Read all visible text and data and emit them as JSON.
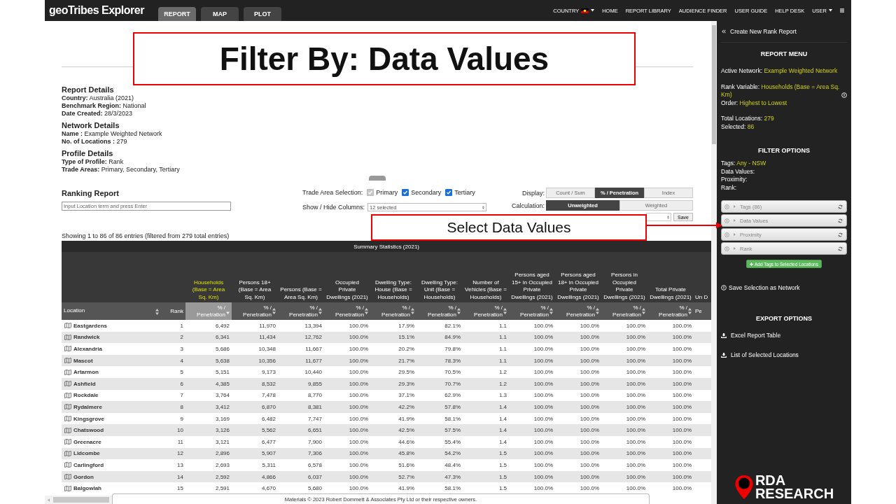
{
  "slide_title": "Filter By: Data Values",
  "callout": "Select Data Values",
  "app": {
    "logo": "geoTribes Explorer",
    "tabs": [
      {
        "label": "REPORT",
        "selected": true
      },
      {
        "label": "MAP",
        "selected": false
      },
      {
        "label": "PLOT",
        "selected": false
      }
    ],
    "nav": [
      {
        "label": "COUNTRY",
        "kind": "flag"
      },
      {
        "label": "HOME",
        "kind": "plain"
      },
      {
        "label": "REPORT LIBRARY",
        "kind": "plain"
      },
      {
        "label": "AUDIENCE FINDER",
        "kind": "plain"
      },
      {
        "label": "USER GUIDE",
        "kind": "plain"
      },
      {
        "label": "HELP DESK",
        "kind": "plain"
      },
      {
        "label": "USER",
        "kind": "caret"
      }
    ]
  },
  "details": [
    {
      "title": "Report Details",
      "lines": [
        "**Country:** Australia (2021)",
        "**Benchmark Region:** National",
        "**Date Created:** 28/3/2023"
      ]
    },
    {
      "title": "Network Details",
      "lines": [
        "**Name :** Example Weighted Network",
        "**No. of Locations :** 279"
      ]
    },
    {
      "title": "Profile Details",
      "lines": [
        "**Type of Profile:** Rank",
        "**Trade Areas:** Primary, Secondary, Tertiary"
      ]
    }
  ],
  "ranking": {
    "title": "Ranking Report",
    "search_placeholder": "Input Location term and press Enter",
    "trade_label": "Trade Area Selection:",
    "trade_areas": [
      {
        "label": "Primary",
        "checked": true,
        "disabled": true
      },
      {
        "label": "Secondary",
        "checked": true,
        "disabled": false
      },
      {
        "label": "Tertiary",
        "checked": true,
        "disabled": false
      }
    ],
    "columns_label": "Show / Hide Columns:",
    "columns_value": "12 selected",
    "display_label": "Display:",
    "display": [
      {
        "label": "Count / Sum",
        "selected": false
      },
      {
        "label": "% / Penetration",
        "selected": true
      },
      {
        "label": "Index",
        "selected": false
      }
    ],
    "calc_label": "Calculation:",
    "calculation": [
      {
        "label": "Unweighted",
        "selected": true
      },
      {
        "label": "Weighted",
        "selected": false
      }
    ],
    "save": "Save"
  },
  "showing": "Showing 1 to 86 of 86 entries (filtered from 279 total entries)",
  "table": {
    "group_heading": "Summary Statistics (2021)",
    "columns": [
      {
        "label": "Location",
        "kind": "name",
        "sortable": true,
        "selected": false
      },
      {
        "label": "Rank",
        "kind": "rank",
        "sortable": false,
        "selected": false
      },
      {
        "label": "Households (Base = Area Sq. Km)",
        "unit": "% / Penetration",
        "kind": "metric",
        "sortable": true,
        "selected": true
      },
      {
        "label": "Persons 18+ (Base = Area Sq. Km)",
        "unit": "% / Penetration",
        "kind": "metric",
        "sortable": true,
        "selected": false
      },
      {
        "label": "Persons (Base = Area Sq. Km)",
        "unit": "% / Penetration",
        "kind": "metric",
        "sortable": true,
        "selected": false
      },
      {
        "label": "Occupied Private Dwellings (2021)",
        "unit": "% / Penetration",
        "kind": "metric",
        "sortable": true,
        "selected": false
      },
      {
        "label": "Dwelling Type: House (Base = Households)",
        "unit": "% / Penetration",
        "kind": "metric",
        "sortable": true,
        "selected": false
      },
      {
        "label": "Dwelling Type: Unit (Base = Households)",
        "unit": "% / Penetration",
        "kind": "metric",
        "sortable": true,
        "selected": false
      },
      {
        "label": "Number of Vehicles (Base = Households)",
        "unit": "% / Penetration",
        "kind": "metric",
        "sortable": true,
        "selected": false
      },
      {
        "label": "Persons aged 15+ in Occupied Private Dwellings (2021)",
        "unit": "% / Penetration",
        "kind": "metric",
        "sortable": true,
        "selected": false
      },
      {
        "label": "Persons aged 18+ in Occupied Private Dwellings (2021)",
        "unit": "% / Penetration",
        "kind": "metric",
        "sortable": true,
        "selected": false
      },
      {
        "label": "Persons in Occupied Private Dwellings (2021)",
        "unit": "% / Penetration",
        "kind": "metric",
        "sortable": true,
        "selected": false
      },
      {
        "label": "Total Private Dwellings (2021)",
        "unit": "% / Penetration",
        "kind": "metric",
        "sortable": true,
        "selected": false
      },
      {
        "label": "Un D",
        "unit": "Pe",
        "kind": "cut",
        "sortable": false,
        "selected": false
      }
    ],
    "rows": [
      [
        "Eastgardens",
        "1",
        "6,492",
        "11,970",
        "13,394",
        "100.0%",
        "17.9%",
        "82.1%",
        "1.1",
        "100.0%",
        "100.0%",
        "100.0%",
        "100.0%"
      ],
      [
        "Randwick",
        "2",
        "6,341",
        "11,434",
        "12,762",
        "100.0%",
        "15.1%",
        "84.9%",
        "1.1",
        "100.0%",
        "100.0%",
        "100.0%",
        "100.0%"
      ],
      [
        "Alexandria",
        "3",
        "5,686",
        "10,348",
        "11,667",
        "100.0%",
        "20.2%",
        "79.8%",
        "1.1",
        "100.0%",
        "100.0%",
        "100.0%",
        "100.0%"
      ],
      [
        "Mascot",
        "4",
        "5,638",
        "10,356",
        "11,677",
        "100.0%",
        "21.7%",
        "78.3%",
        "1.1",
        "100.0%",
        "100.0%",
        "100.0%",
        "100.0%"
      ],
      [
        "Artarmon",
        "5",
        "5,151",
        "9,173",
        "10,440",
        "100.0%",
        "29.5%",
        "70.5%",
        "1.2",
        "100.0%",
        "100.0%",
        "100.0%",
        "100.0%"
      ],
      [
        "Ashfield",
        "6",
        "4,385",
        "8,532",
        "9,855",
        "100.0%",
        "29.3%",
        "70.7%",
        "1.2",
        "100.0%",
        "100.0%",
        "100.0%",
        "100.0%"
      ],
      [
        "Rockdale",
        "7",
        "3,764",
        "7,478",
        "8,770",
        "100.0%",
        "37.1%",
        "62.9%",
        "1.3",
        "100.0%",
        "100.0%",
        "100.0%",
        "100.0%"
      ],
      [
        "Rydalmere",
        "8",
        "3,412",
        "6,870",
        "8,381",
        "100.0%",
        "42.2%",
        "57.8%",
        "1.4",
        "100.0%",
        "100.0%",
        "100.0%",
        "100.0%"
      ],
      [
        "Kingsgrove",
        "9",
        "3,169",
        "6,482",
        "7,747",
        "100.0%",
        "41.9%",
        "58.1%",
        "1.4",
        "100.0%",
        "100.0%",
        "100.0%",
        "100.0%"
      ],
      [
        "Chatswood",
        "10",
        "3,126",
        "5,562",
        "6,651",
        "100.0%",
        "42.5%",
        "57.5%",
        "1.4",
        "100.0%",
        "100.0%",
        "100.0%",
        "100.0%"
      ],
      [
        "Greenacre",
        "11",
        "3,121",
        "6,477",
        "7,900",
        "100.0%",
        "44.6%",
        "55.4%",
        "1.4",
        "100.0%",
        "100.0%",
        "100.0%",
        "100.0%"
      ],
      [
        "Lidcombe",
        "12",
        "2,896",
        "5,907",
        "7,306",
        "100.0%",
        "45.8%",
        "54.2%",
        "1.5",
        "100.0%",
        "100.0%",
        "100.0%",
        "100.0%"
      ],
      [
        "Carlingford",
        "13",
        "2,693",
        "5,311",
        "6,578",
        "100.0%",
        "51.6%",
        "48.4%",
        "1.5",
        "100.0%",
        "100.0%",
        "100.0%",
        "100.0%"
      ],
      [
        "Gordon",
        "14",
        "2,592",
        "4,866",
        "6,037",
        "100.0%",
        "52.7%",
        "47.3%",
        "1.5",
        "100.0%",
        "100.0%",
        "100.0%",
        "100.0%"
      ],
      [
        "Balgowlah",
        "15",
        "2,591",
        "4,670",
        "5,680",
        "100.0%",
        "41.9%",
        "58.1%",
        "1.5",
        "100.0%",
        "100.0%",
        "100.0%",
        "100.0%"
      ]
    ]
  },
  "footer": "Materials © 2023 Robert Dommett & Associates Pty Ltd or their respective owners.",
  "sidebar": {
    "back": "Create New Rank Report",
    "menu_title": "REPORT MENU",
    "info": [
      [
        {
          "label": "Active Network:",
          "value": "Example Weighted Network",
          "info": false
        }
      ],
      [
        {
          "label": "Rank Variable:",
          "value": "Households (Base = Area Sq. Km)",
          "info": true
        },
        {
          "label": "Order:",
          "value": "Highest to Lowest",
          "info": false
        }
      ],
      [
        {
          "label": "Total Locations:",
          "value": "279",
          "info": false
        },
        {
          "label": "Selected:",
          "value": "86",
          "info": false
        }
      ]
    ],
    "filter_title": "FILTER OPTIONS",
    "filters": [
      {
        "label": "Tags:",
        "value": "Any - NSW"
      },
      {
        "label": "Data Values:"
      },
      {
        "label": "Proximity:"
      },
      {
        "label": "Rank:"
      }
    ],
    "accordion": [
      "Tags (86)",
      "Data Values",
      "Proximity",
      "Rank"
    ],
    "add_button": "Add Tags to Selected Locations",
    "save_network": "Save Selection as Network",
    "export_title": "EXPORT OPTIONS",
    "exports": [
      "Excel Report Table",
      "List of Selected Locations"
    ],
    "brand": [
      "RDA",
      "RESEARCH"
    ]
  }
}
